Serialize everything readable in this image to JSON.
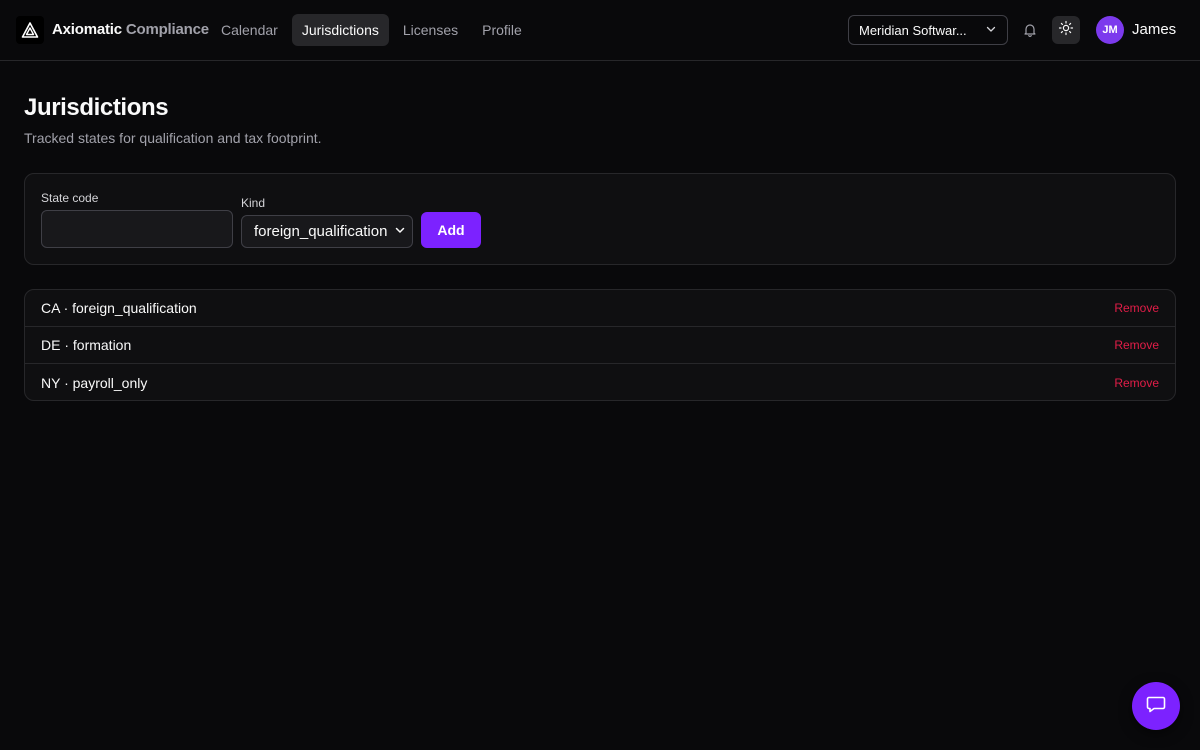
{
  "header": {
    "brand_primary": "Axiomatic",
    "brand_secondary": "Compliance",
    "logo_icon": "triangle-logo-icon",
    "nav": [
      {
        "label": "Calendar"
      },
      {
        "label": "Jurisdictions",
        "active": true
      },
      {
        "label": "Licenses"
      },
      {
        "label": "Profile"
      }
    ],
    "org_select": {
      "value": "Meridian Softwar..."
    },
    "user": {
      "initials": "JM",
      "name": "James"
    }
  },
  "page": {
    "title": "Jurisdictions",
    "subtitle": "Tracked states for qualification and tax footprint."
  },
  "form": {
    "state_label": "State code",
    "state_value": "",
    "kind_label": "Kind",
    "kind_value": "foreign_qualification",
    "add_label": "Add"
  },
  "jurisdictions": [
    {
      "label": "CA · foreign_qualification",
      "remove": "Remove"
    },
    {
      "label": "DE · formation",
      "remove": "Remove"
    },
    {
      "label": "NY · payroll_only",
      "remove": "Remove"
    }
  ],
  "colors": {
    "accent": "#7c22ff",
    "danger": "#e11d48",
    "background": "#09090b"
  }
}
